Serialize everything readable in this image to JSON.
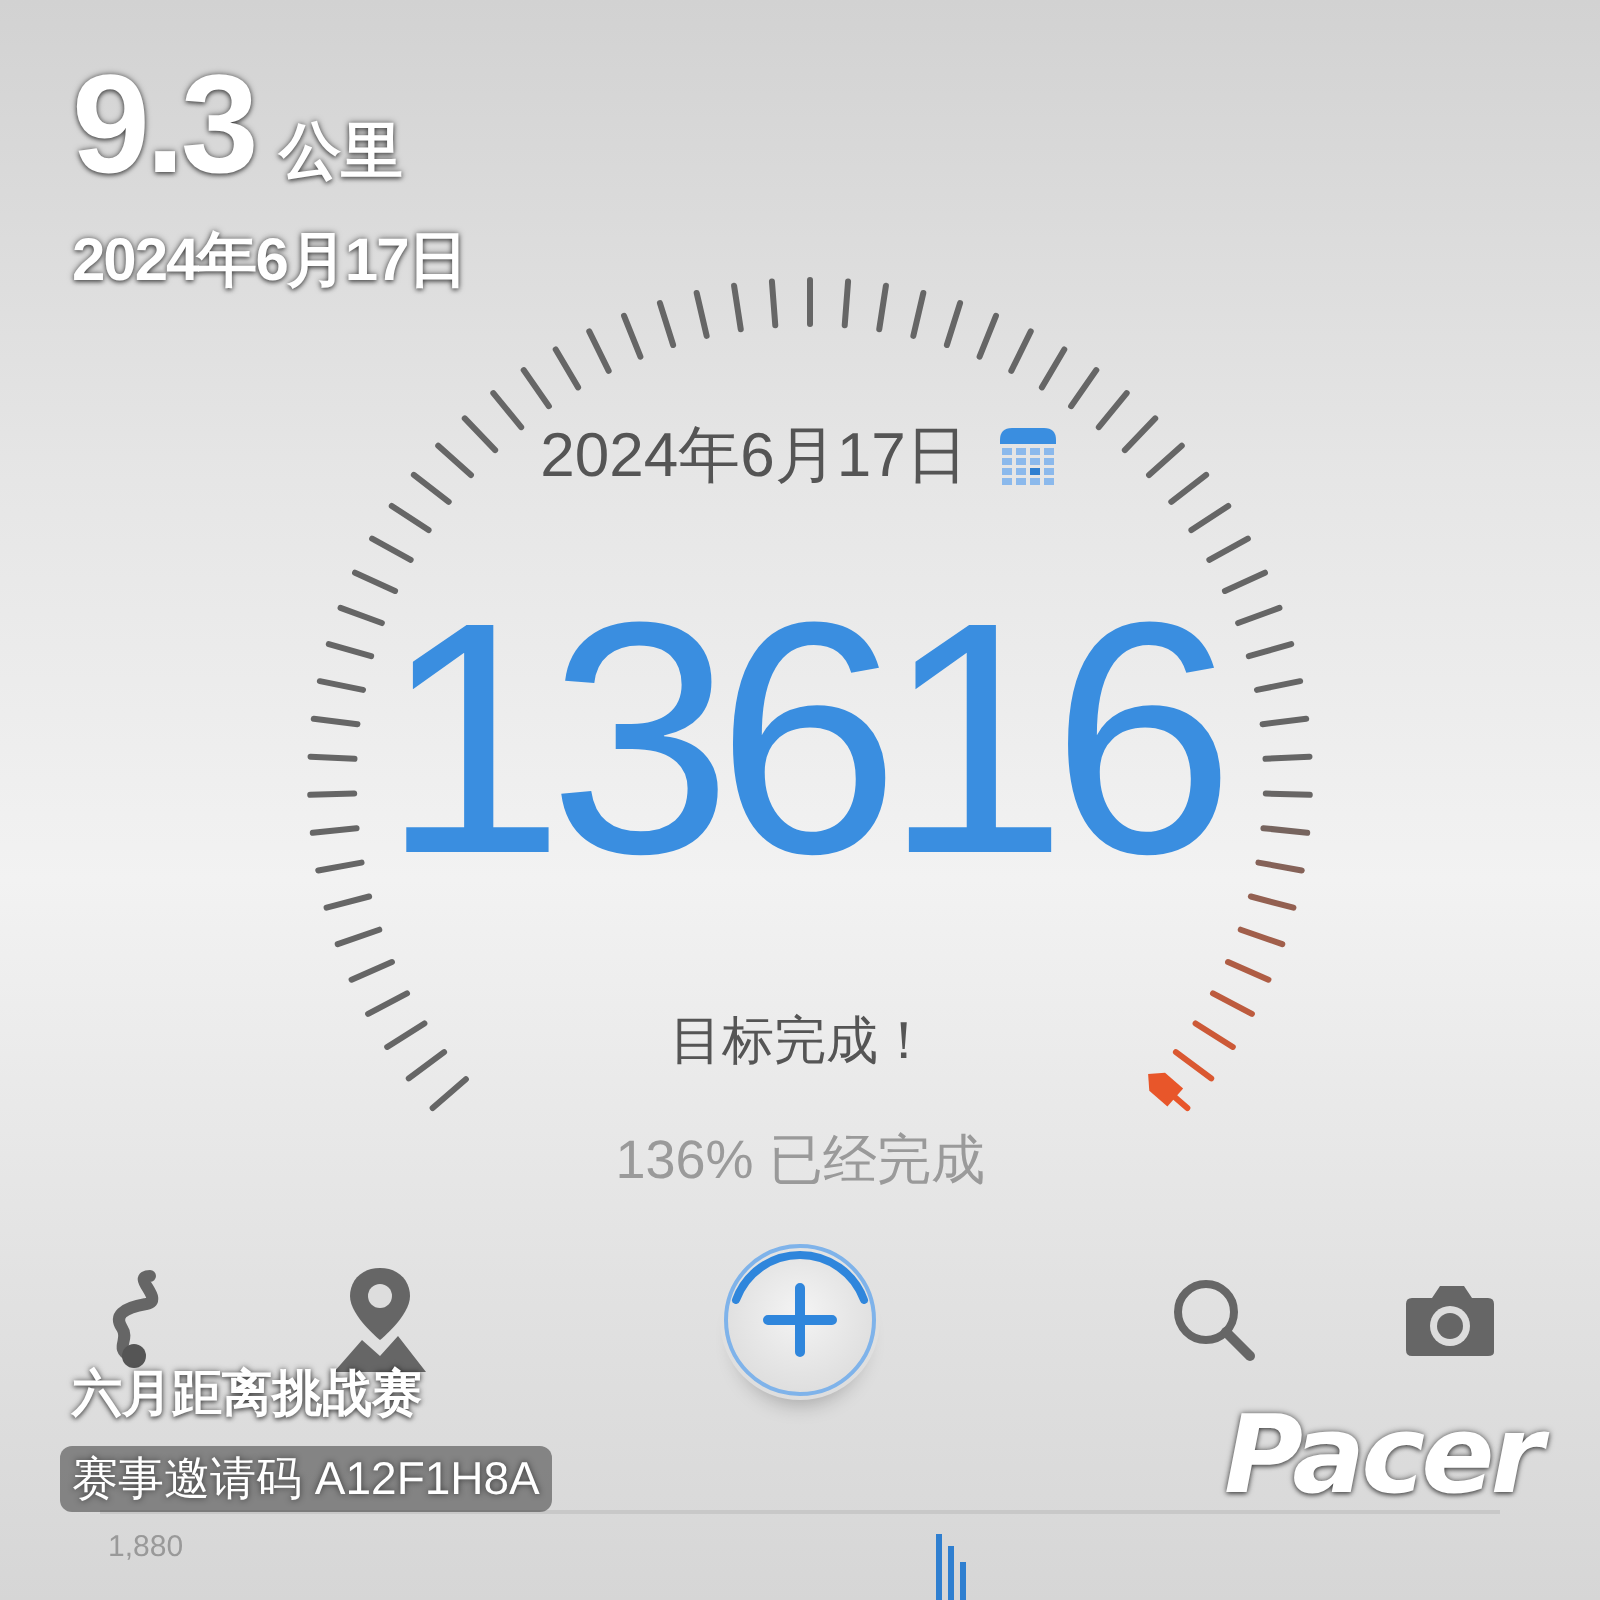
{
  "overlay": {
    "distance": "9.3",
    "unit": "公里",
    "date": "2024年6月17日",
    "challenge": "六月距离挑战赛",
    "invite": "赛事邀请码 A12F1H8A",
    "logo": "Pacer"
  },
  "dashboard": {
    "date": "2024年6月17日",
    "steps": "13616",
    "status": "目标完成！",
    "percent": "136% 已经完成"
  },
  "toolbar": [
    {
      "kind": "route"
    },
    {
      "kind": "map"
    },
    {
      "kind": "add"
    },
    {
      "kind": "search"
    },
    {
      "kind": "camera"
    }
  ],
  "chart": {
    "axis_label": "1,880"
  }
}
